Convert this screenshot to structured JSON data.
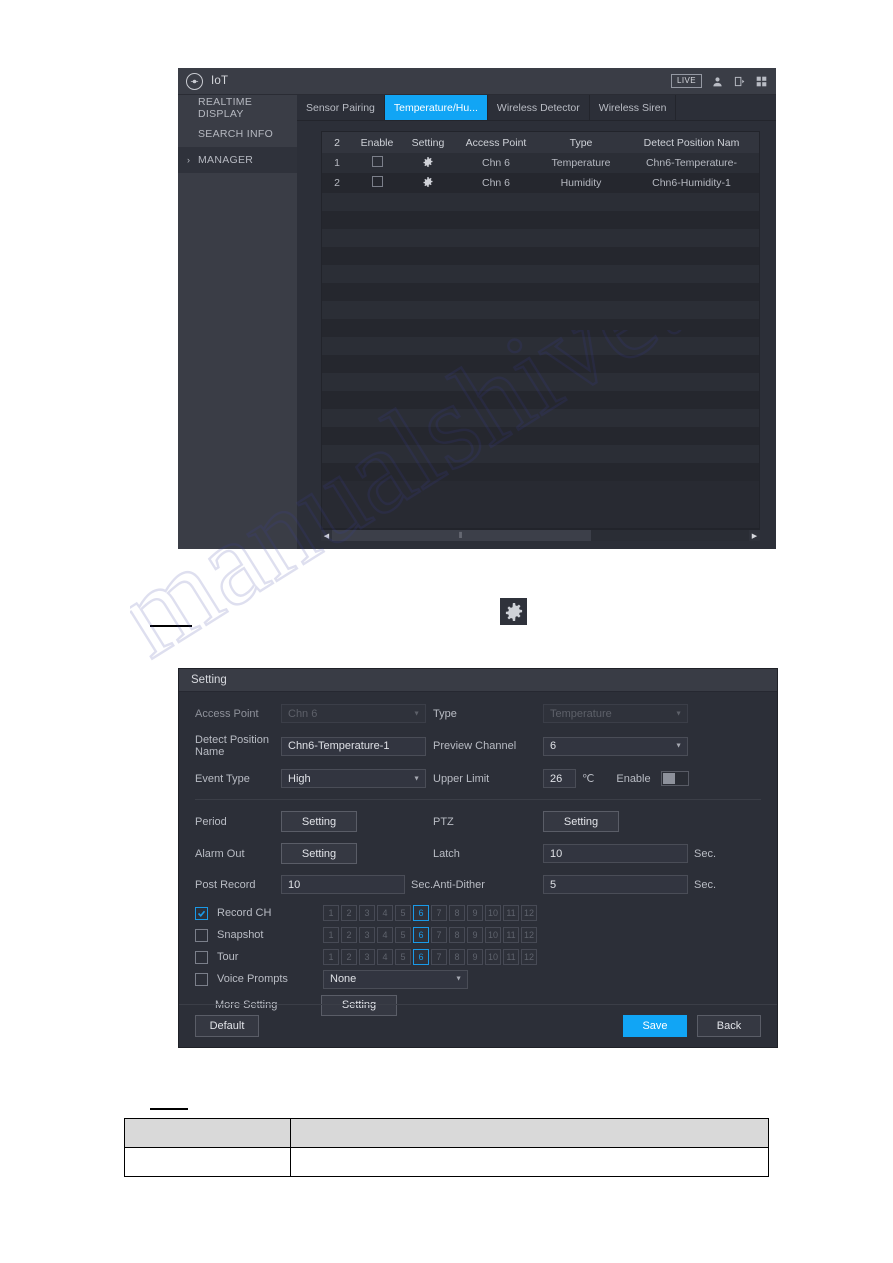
{
  "iot_window": {
    "title": "IoT",
    "logo_icon": "iot-circle-icon",
    "titlebar": {
      "live_label": "LIVE",
      "icons": [
        "user-icon",
        "logout-icon",
        "grid-icon"
      ]
    },
    "sidebar": {
      "items": [
        {
          "label": "REALTIME DISPLAY",
          "active": false,
          "caret": ""
        },
        {
          "label": "SEARCH INFO",
          "active": false,
          "caret": ""
        },
        {
          "label": "MANAGER",
          "active": true,
          "caret": "›"
        }
      ]
    },
    "tabs": [
      {
        "label": "Sensor Pairing",
        "active": false
      },
      {
        "label": "Temperature/Hu...",
        "active": true
      },
      {
        "label": "Wireless Detector",
        "active": false
      },
      {
        "label": "Wireless Siren",
        "active": false
      }
    ],
    "table": {
      "headers": [
        "2",
        "Enable",
        "Setting",
        "Access Point",
        "Type",
        "Detect Position Nam"
      ],
      "rows": [
        {
          "no": "1",
          "enable": false,
          "setting_icon": "gear-icon",
          "access_point": "Chn 6",
          "type": "Temperature",
          "detect_position_name": "Chn6-Temperature-"
        },
        {
          "no": "2",
          "enable": false,
          "setting_icon": "gear-icon",
          "access_point": "Chn 6",
          "type": "Humidity",
          "detect_position_name": "Chn6-Humidity-1"
        }
      ]
    },
    "scrollbar": {
      "left_arrow": "◀",
      "right_arrow": "▶",
      "grip": "⦀"
    }
  },
  "standalone_gear": {
    "icon": "gear-icon"
  },
  "setting_dialog": {
    "title": "Setting",
    "fields": {
      "access_point_label": "Access Point",
      "access_point_value": "Chn 6",
      "type_label": "Type",
      "type_value": "Temperature",
      "detect_position_name_label": "Detect Position Name",
      "detect_position_name_value": "Chn6-Temperature-1",
      "preview_channel_label": "Preview Channel",
      "preview_channel_value": "6",
      "event_type_label": "Event Type",
      "event_type_value": "High",
      "upper_limit_label": "Upper Limit",
      "upper_limit_value": "26",
      "upper_limit_unit": "℃",
      "enable_label": "Enable",
      "enable_on": false,
      "period_label": "Period",
      "period_button": "Setting",
      "ptz_label": "PTZ",
      "ptz_button": "Setting",
      "alarm_out_label": "Alarm Out",
      "alarm_out_button": "Setting",
      "latch_label": "Latch",
      "latch_value": "10",
      "latch_unit": "Sec.",
      "post_record_label": "Post Record",
      "post_record_value": "10",
      "post_record_unit": "Sec.",
      "anti_dither_label": "Anti-Dither",
      "anti_dither_value": "5",
      "anti_dither_unit": "Sec.",
      "more_setting_label": "More Setting",
      "more_setting_button": "Setting"
    },
    "channel_rows": [
      {
        "label": "Record CH",
        "checked": true,
        "channels": [
          "1",
          "2",
          "3",
          "4",
          "5",
          "6",
          "7",
          "8",
          "9",
          "10",
          "11",
          "12"
        ],
        "selected": "6"
      },
      {
        "label": "Snapshot",
        "checked": false,
        "channels": [
          "1",
          "2",
          "3",
          "4",
          "5",
          "6",
          "7",
          "8",
          "9",
          "10",
          "11",
          "12"
        ],
        "selected": "6"
      },
      {
        "label": "Tour",
        "checked": false,
        "channels": [
          "1",
          "2",
          "3",
          "4",
          "5",
          "6",
          "7",
          "8",
          "9",
          "10",
          "11",
          "12"
        ],
        "selected": "6"
      }
    ],
    "voice_prompts": {
      "label": "Voice Prompts",
      "checked": false,
      "value": "None"
    },
    "footer": {
      "default_label": "Default",
      "save_label": "Save",
      "back_label": "Back"
    },
    "accent_color": "#11a5f5"
  },
  "doc_table": {
    "rows": [
      {
        "cells": [
          "",
          ""
        ],
        "header": true
      },
      {
        "cells": [
          "",
          ""
        ],
        "header": false
      }
    ]
  },
  "watermark": {
    "text": "manualshive.com"
  }
}
